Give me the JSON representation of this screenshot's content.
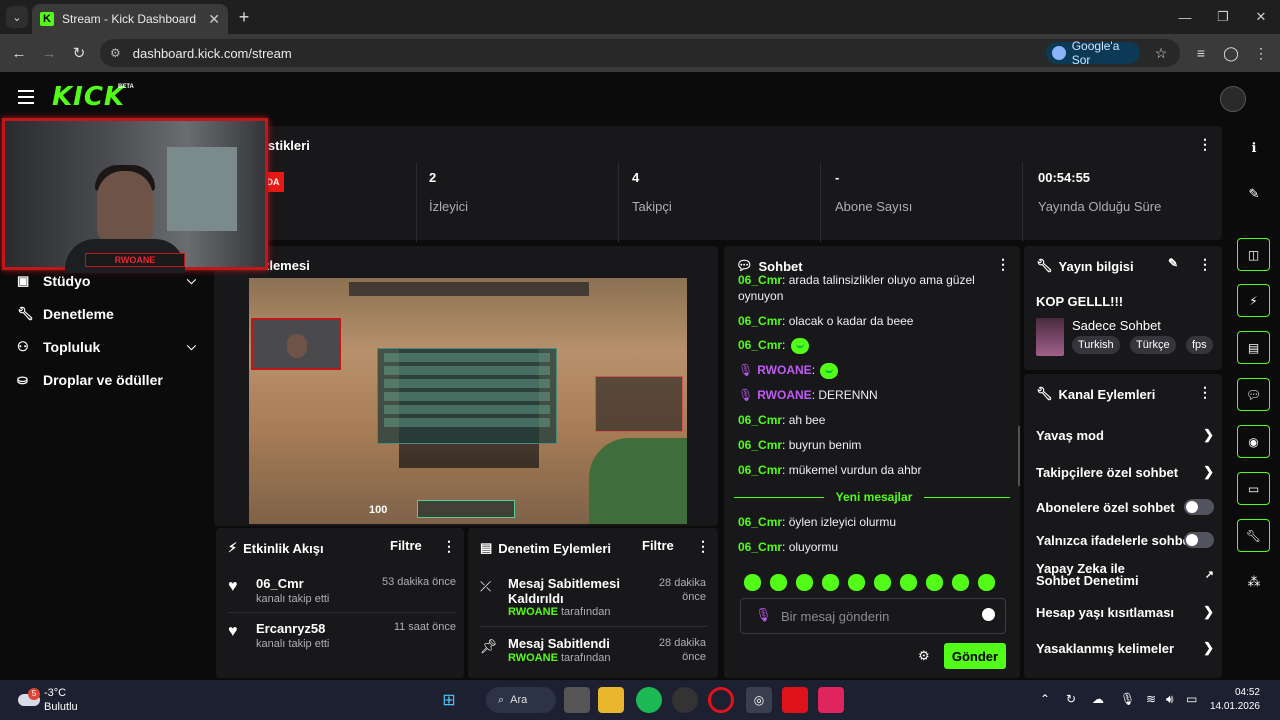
{
  "browser": {
    "tab_title": "Stream - Kick Dashboard",
    "tab_close": "✕",
    "new_tab": "+",
    "url": "dashboard.kick.com/stream",
    "google_sor": "Google'a Sor",
    "window_controls": [
      "—",
      "❐",
      "✕"
    ]
  },
  "app": {
    "logo": "KICK",
    "beta": "BETA",
    "accent": "#53fc18"
  },
  "webcam": {
    "tag": "RWOANE"
  },
  "stats": {
    "title": "n İstatistikleri",
    "live_badge": "DA",
    "items": [
      {
        "value": "2",
        "label": "İzleyici"
      },
      {
        "value": "4",
        "label": "Takipçi"
      },
      {
        "value": "-",
        "label": "Abone Sayısı"
      },
      {
        "value": "00:54:55",
        "label": "Yayında Olduğu Süre"
      }
    ]
  },
  "sidebar": {
    "items": [
      {
        "label": "Stüdyo",
        "icon": "studio-icon"
      },
      {
        "label": "Denetleme",
        "icon": "wrench-icon"
      },
      {
        "label": "Topluluk",
        "icon": "community-icon"
      },
      {
        "label": "Droplar ve ödüller",
        "icon": "drops-icon"
      }
    ]
  },
  "preview": {
    "title": "n Ön İzlemesi",
    "hp": "100"
  },
  "activity": {
    "title": "Etkinlik Akışı",
    "filter": "Filtre",
    "items": [
      {
        "name": "06_Cmr",
        "sub": "kanalı takip etti",
        "time": "53 dakika önce"
      },
      {
        "name": "Ercanryz58",
        "sub": "kanalı takip etti",
        "time": "11 saat önce"
      }
    ]
  },
  "moderation": {
    "title": "Denetim Eylemleri",
    "filter": "Filtre",
    "items": [
      {
        "title": "Mesaj Sabitlemesi Kaldırıldı",
        "user": "RWOANE",
        "by": "tarafından",
        "time": "28 dakika önce"
      },
      {
        "title": "Mesaj Sabitlendi",
        "user": "RWOANE",
        "by": "tarafından",
        "time": "28 dakika önce"
      }
    ]
  },
  "chat": {
    "title": "Sohbet",
    "messages": [
      {
        "user": "06_Cmr",
        "text": "arada talinsizlikler oluyo ama güzel oynuyon"
      },
      {
        "user": "06_Cmr",
        "text": "olacak o kadar da beee"
      },
      {
        "user": "06_Cmr",
        "text": ""
      },
      {
        "user": "RWOANE",
        "text": ""
      },
      {
        "user": "RWOANE",
        "text": "DERENNN"
      },
      {
        "user": "06_Cmr",
        "text": "ah bee"
      },
      {
        "user": "06_Cmr",
        "text": "buyrun benim"
      },
      {
        "user": "06_Cmr",
        "text": "mükemel vurdun da ahbr"
      },
      {
        "user": "06_Cmr",
        "text": "öylen izleyici olurmu"
      },
      {
        "user": "06_Cmr",
        "text": "oluyormu"
      }
    ],
    "new_messages": "Yeni mesajlar",
    "placeholder": "Bir mesaj gönderin",
    "send": "Gönder"
  },
  "stream_info": {
    "title": "Yayın bilgisi",
    "stream_title": "KOP GELLL!!!",
    "category": "Sadece Sohbet",
    "tags": [
      "Turkish",
      "Türkçe",
      "fps"
    ]
  },
  "channel_actions": {
    "title": "Kanal Eylemleri",
    "items": [
      {
        "label": "Yavaş mod",
        "control": "arrow"
      },
      {
        "label": "Takipçilere özel sohbet",
        "control": "arrow"
      },
      {
        "label": "Abonelere özel sohbet",
        "control": "toggle",
        "on": false
      },
      {
        "label": "Yalnızca ifadelerle sohbet",
        "control": "toggle",
        "on": false
      },
      {
        "label": "Yapay Zeka ile Sohbet Denetimi",
        "control": "external"
      },
      {
        "label": "Hesap yaşı kısıtlaması",
        "control": "arrow"
      },
      {
        "label": "Yasaklanmış kelimeler",
        "control": "arrow"
      }
    ]
  },
  "taskbar": {
    "temp": "-3°C",
    "weather": "Bulutlu",
    "weather_badge": "5",
    "search": "Ara",
    "time": "04:52",
    "date": "14.01.2026"
  }
}
